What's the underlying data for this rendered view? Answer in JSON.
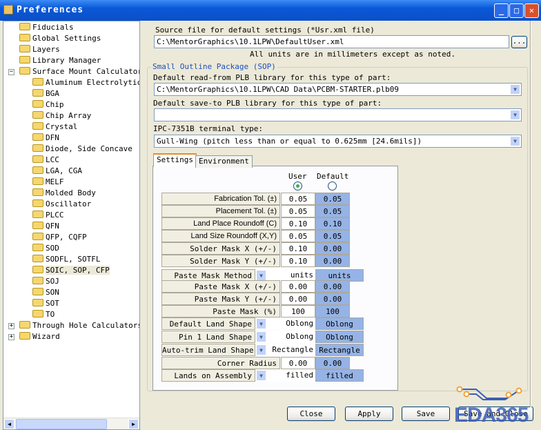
{
  "window": {
    "title": "Preferences",
    "minimize": "_",
    "maximize": "□",
    "close": "✕"
  },
  "tree": [
    {
      "label": "Fiducials",
      "level": 0
    },
    {
      "label": "Global Settings",
      "level": 0
    },
    {
      "label": "Layers",
      "level": 0
    },
    {
      "label": "Library Manager",
      "level": 0
    },
    {
      "label": "Surface Mount Calculators",
      "level": 0,
      "expander": "−"
    },
    {
      "label": "Aluminum Electrolytic Capacitor",
      "level": 1
    },
    {
      "label": "BGA",
      "level": 1
    },
    {
      "label": "Chip",
      "level": 1
    },
    {
      "label": "Chip Array",
      "level": 1
    },
    {
      "label": "Crystal",
      "level": 1
    },
    {
      "label": "DFN",
      "level": 1
    },
    {
      "label": "Diode, Side Concave",
      "level": 1
    },
    {
      "label": "LCC",
      "level": 1
    },
    {
      "label": "LGA, CGA",
      "level": 1
    },
    {
      "label": "MELF",
      "level": 1
    },
    {
      "label": "Molded Body",
      "level": 1
    },
    {
      "label": "Oscillator",
      "level": 1
    },
    {
      "label": "PLCC",
      "level": 1
    },
    {
      "label": "QFN",
      "level": 1
    },
    {
      "label": "QFP, CQFP",
      "level": 1
    },
    {
      "label": "SOD",
      "level": 1
    },
    {
      "label": "SODFL, SOTFL",
      "level": 1
    },
    {
      "label": "SOIC, SOP, CFP",
      "level": 1,
      "selected": true
    },
    {
      "label": "SOJ",
      "level": 1
    },
    {
      "label": "SON",
      "level": 1
    },
    {
      "label": "SOT",
      "level": 1
    },
    {
      "label": "TO",
      "level": 1
    },
    {
      "label": "Through Hole Calculators",
      "level": 0,
      "expander": "+"
    },
    {
      "label": "Wizard",
      "level": 0,
      "expander": "+"
    }
  ],
  "source": {
    "label": "Source file for default settings (*Usr.xml file)",
    "value": "C:\\MentorGraphics\\10.1LPW\\DefaultUser.xml",
    "browse": "...",
    "note": "All units are in millimeters except as noted."
  },
  "group": {
    "title": "Small Outline Package (SOP)",
    "read_label": "Default read-from PLB library for this type of part:",
    "read_value": "C:\\MentorGraphics\\10.1LPW\\CAD Data\\PCBM-STARTER.plb09",
    "save_label": "Default save-to PLB library for this type of part:",
    "save_value": "",
    "terminal_label": "IPC-7351B terminal type:",
    "terminal_value": "Gull-Wing (pitch less than or equal to 0.625mm [24.6mils])"
  },
  "tabs": [
    {
      "label": "Settings",
      "active": true
    },
    {
      "label": "Environment"
    }
  ],
  "columns": {
    "user": "User",
    "default": "Default",
    "selected": "user"
  },
  "rows": [
    {
      "label": "Fabrication Tol. (±)",
      "user": "0.05",
      "default": "0.05"
    },
    {
      "label": "Placement Tol. (±)",
      "user": "0.05",
      "default": "0.05"
    },
    {
      "label": "Land Place Roundoff (C)",
      "user": "0.10",
      "default": "0.10"
    },
    {
      "label": "Land Size Roundoff (X,Y)",
      "user": "0.05",
      "default": "0.05"
    },
    {
      "label": "Solder Mask X (+/-)",
      "user": "0.10",
      "default": "0.00",
      "mono": true
    },
    {
      "label": "Solder Mask Y (+/-)",
      "user": "0.10",
      "default": "0.00",
      "mono": true
    },
    {
      "label": "Paste Mask Method",
      "user": "units",
      "default": "units",
      "mono": true,
      "dropdown": true
    },
    {
      "label": "Paste Mask X (+/-)",
      "user": "0.00",
      "default": "0.00",
      "mono": true
    },
    {
      "label": "Paste Mask Y (+/-)",
      "user": "0.00",
      "default": "0.00",
      "mono": true
    },
    {
      "label": "Paste Mask (%)",
      "user": "100",
      "default": "100",
      "mono": true
    },
    {
      "label": "Default Land Shape",
      "user": "Oblong",
      "default": "Oblong",
      "mono": true,
      "dropdown": true
    },
    {
      "label": "Pin 1 Land Shape",
      "user": "Oblong",
      "default": "Oblong",
      "mono": true,
      "dropdown": true
    },
    {
      "label": "Auto-trim Land Shape",
      "user": "Rectangle",
      "default": "Rectangle",
      "mono": true,
      "dropdown": true
    },
    {
      "label": "Corner Radius",
      "user": "0.00",
      "default": "0.00",
      "mono": true
    },
    {
      "label": "Lands on Assembly",
      "user": "filled",
      "default": "filled",
      "mono": true,
      "dropdown": true
    }
  ],
  "buttons": {
    "close": "Close",
    "apply": "Apply",
    "save": "Save",
    "save_close": "Save and Close"
  },
  "watermark": "EDA365",
  "colors": {
    "titlebar": "#0A58D8",
    "default_cell": "#95B3E6",
    "panel": "#ECE9D8"
  }
}
